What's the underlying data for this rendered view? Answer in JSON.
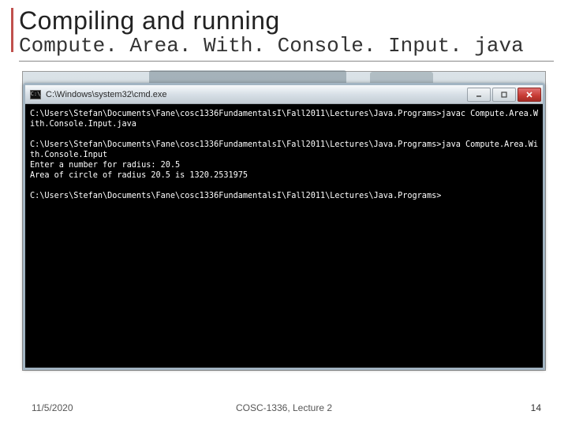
{
  "slide": {
    "title": "Compiling and running",
    "subtitle": "Compute. Area. With. Console. Input. java"
  },
  "cmd": {
    "window_title": "C:\\Windows\\system32\\cmd.exe",
    "icon_label": "C:\\",
    "buttons": {
      "minimize": "minimize",
      "maximize": "maximize",
      "close": "close"
    },
    "terminal_text": "C:\\Users\\Stefan\\Documents\\Fane\\cosc1336FundamentalsI\\Fall2011\\Lectures\\Java.Programs>javac Compute.Area.With.Console.Input.java\n\nC:\\Users\\Stefan\\Documents\\Fane\\cosc1336FundamentalsI\\Fall2011\\Lectures\\Java.Programs>java Compute.Area.With.Console.Input\nEnter a number for radius: 20.5\nArea of circle of radius 20.5 is 1320.2531975\n\nC:\\Users\\Stefan\\Documents\\Fane\\cosc1336FundamentalsI\\Fall2011\\Lectures\\Java.Programs>"
  },
  "footer": {
    "date": "11/5/2020",
    "center": "COSC-1336, Lecture 2",
    "page": "14"
  }
}
